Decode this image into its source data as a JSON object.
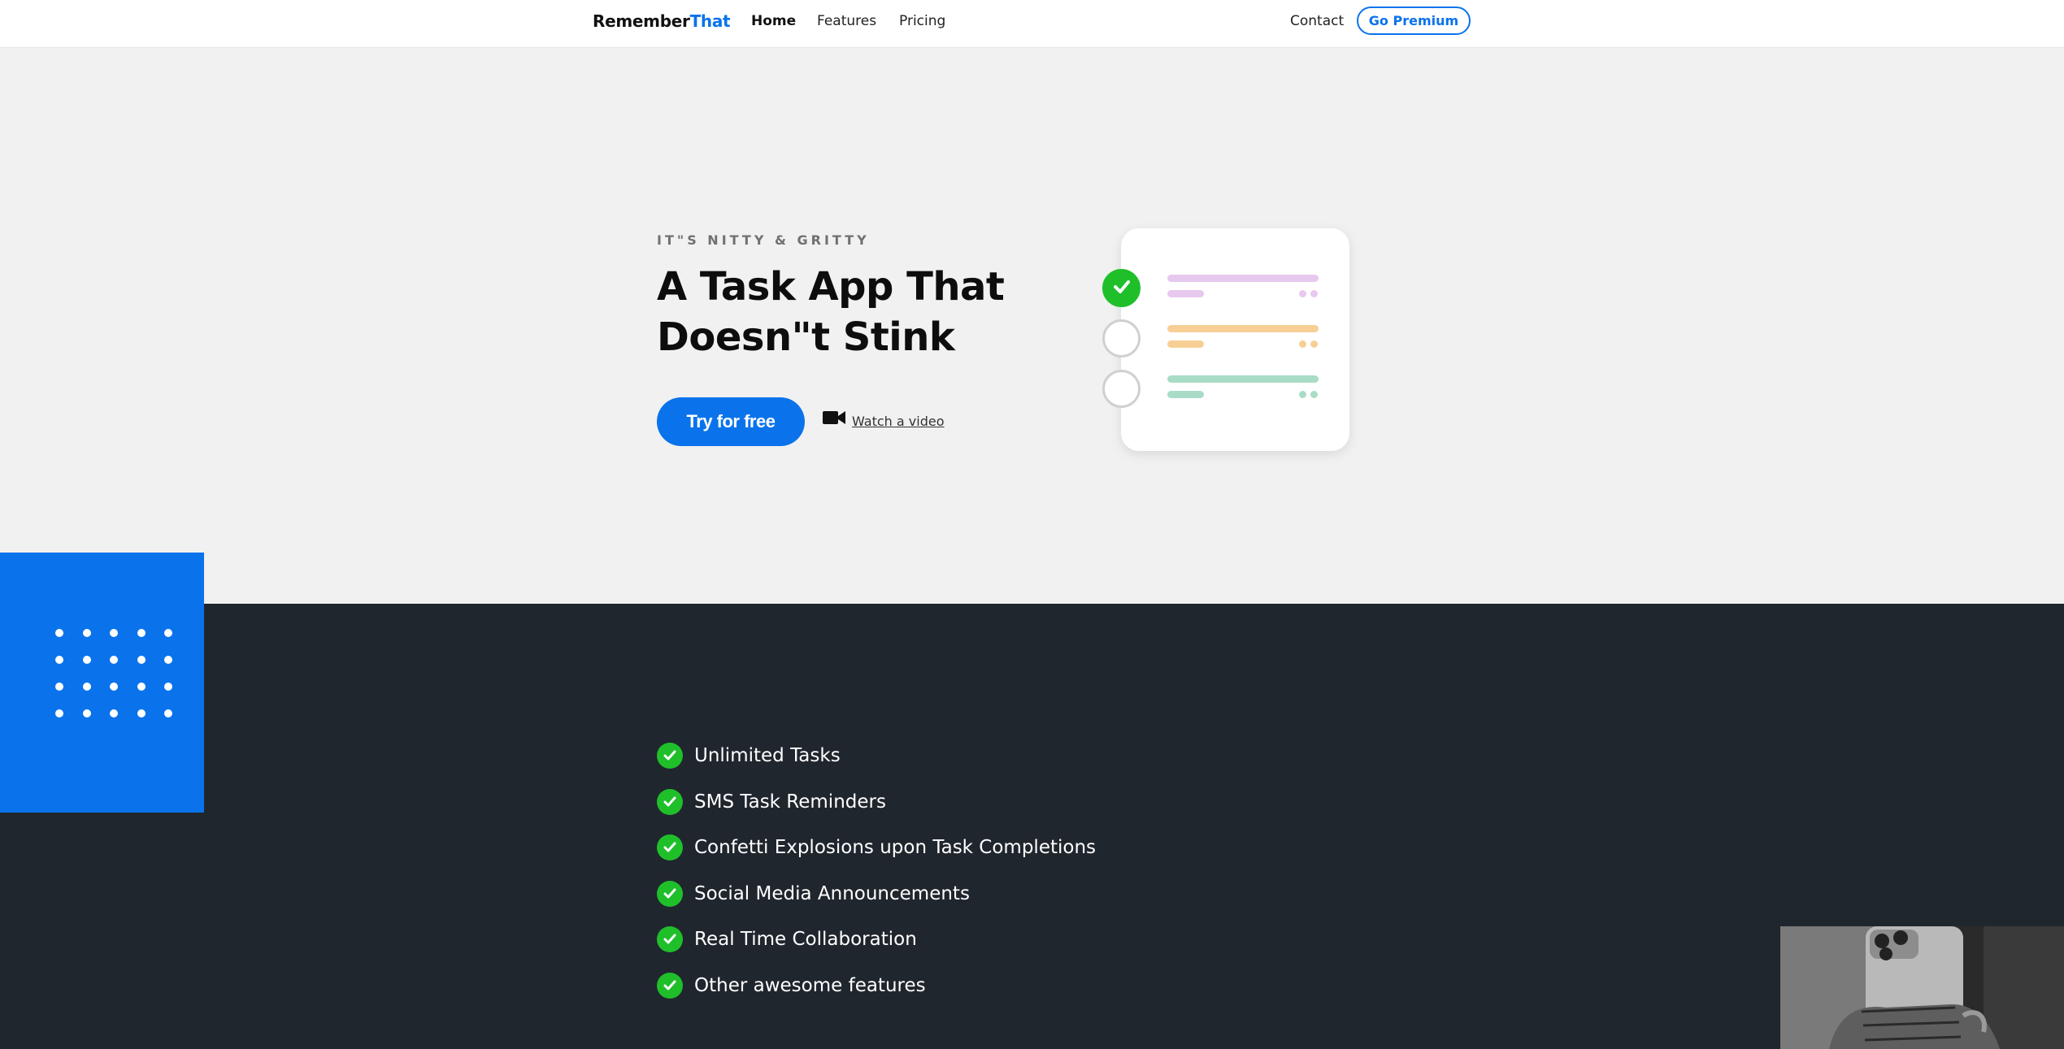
{
  "nav": {
    "logo_primary": "Remember",
    "logo_accent": "That",
    "links": [
      {
        "label": "Home",
        "active": true
      },
      {
        "label": "Features",
        "active": false
      },
      {
        "label": "Pricing",
        "active": false
      }
    ],
    "contact_label": "Contact",
    "premium_label": "Go Premium"
  },
  "hero": {
    "eyebrow": "IT\"S NITTY & GRITTY",
    "headline": "A Task App That Doesn\"t Stink",
    "cta_label": "Try for free",
    "video_icon": "video-camera-icon",
    "video_label": "Watch a video"
  },
  "task_card": {
    "items": [
      {
        "done": true,
        "color": "#e7c8ef"
      },
      {
        "done": false,
        "color": "#f7cf95"
      },
      {
        "done": false,
        "color": "#a9dcc6"
      }
    ]
  },
  "features": {
    "check_icon": "check-circle-icon",
    "items": [
      "Unlimited Tasks",
      "SMS Task Reminders",
      "Confetti Explosions upon Task Completions",
      "Social Media Announcements",
      "Real Time Collaboration",
      "Other awesome features"
    ]
  },
  "colors": {
    "brand": "#0a73eb",
    "success": "#1fbf2a",
    "dark_bg": "#20262e",
    "hero_bg": "#f1f1f1"
  }
}
